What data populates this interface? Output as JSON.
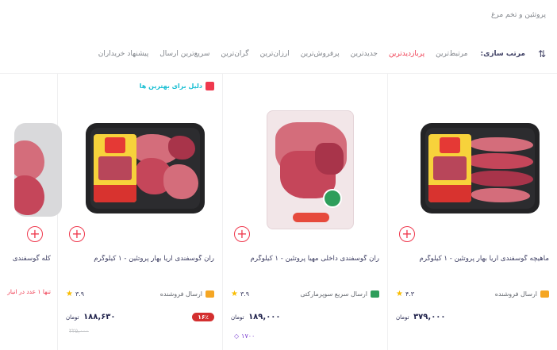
{
  "breadcrumb": "پروتئین و تخم مرغ",
  "sort": {
    "label": "مرتب سازی:",
    "options": [
      {
        "label": "مرتبط‌ترین",
        "active": false
      },
      {
        "label": "پربازدیدترین",
        "active": true
      },
      {
        "label": "جدیدترین",
        "active": false
      },
      {
        "label": "پرفروش‌ترین",
        "active": false
      },
      {
        "label": "ارزان‌ترین",
        "active": false
      },
      {
        "label": "گران‌ترین",
        "active": false
      },
      {
        "label": "سریع‌ترین ارسال",
        "active": false
      },
      {
        "label": "پیشنهاد خریداران",
        "active": false
      }
    ]
  },
  "products": [
    {
      "title": "ماهیچه گوسفندی آریا بهار پروتئین - ۱ کیلوگرم",
      "shipping": "ارسال فروشنده",
      "rating": "۴.۳",
      "price": "۳۷۹,۰۰۰",
      "currency": "تومان",
      "add_label": "+"
    },
    {
      "title": "ران گوسفندی داخلی مهیا پروتئین - ۱ کیلوگرم",
      "shipping": "ارسال سریع سوپرمارکتی",
      "rating": "۳.۹",
      "price": "۱۸۹,۰۰۰",
      "currency": "تومان",
      "add_label": "+",
      "club_price": "۱۷۰۰"
    },
    {
      "promo": "دلیل برای بهترین ها",
      "title": "ران گوسفندی آریا بهار پروتئین - ۱ کیلوگرم",
      "shipping": "ارسال فروشنده",
      "rating": "۳.۹",
      "discount": "۱۶٪",
      "price": "۱۸۸,۶۳۰",
      "currency": "تومان",
      "old_price": "۲۲۵,۰۰۰",
      "add_label": "+"
    },
    {
      "title": "کله گوسفندی",
      "stock": "تنها ۱ عدد در انبار",
      "add_label": "+"
    }
  ],
  "colors": {
    "accent": "#ef394e",
    "teal": "#19bfd3",
    "star": "#f9bc00",
    "club": "#7a3fd0"
  }
}
